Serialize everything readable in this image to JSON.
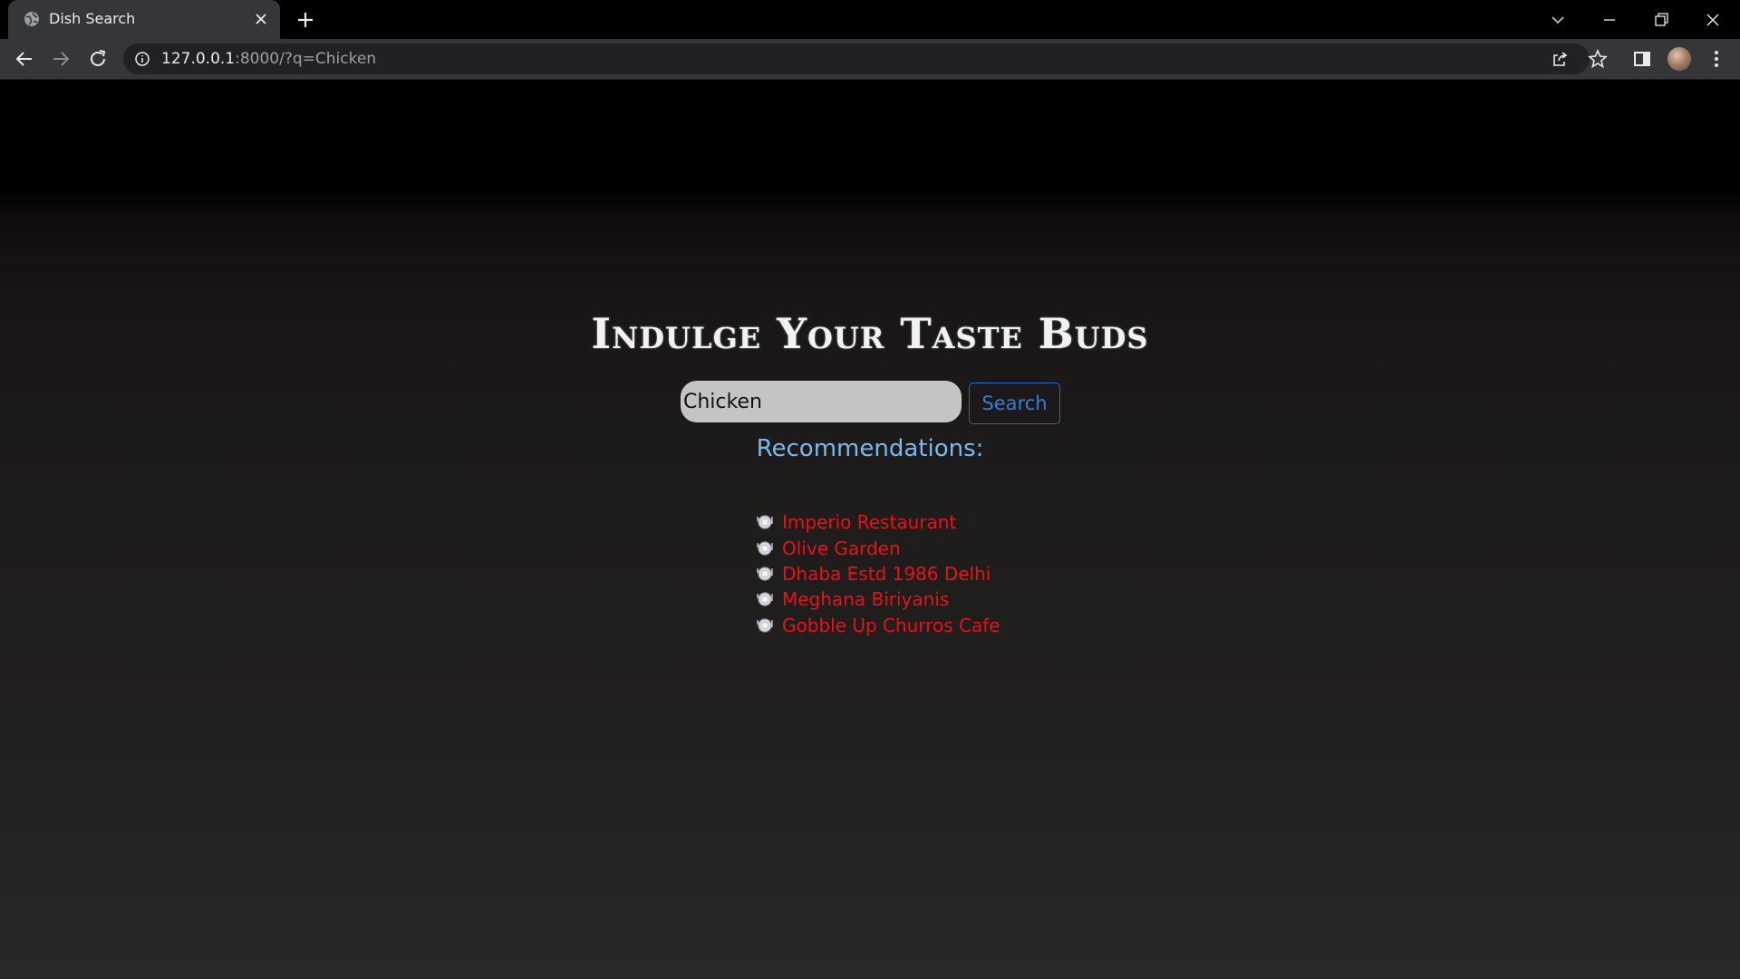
{
  "browser": {
    "tab_title": "Dish Search",
    "url_host": "127.0.0.1",
    "url_rest": ":8000/?q=Chicken"
  },
  "page": {
    "heading": "Indulge Your Taste Buds",
    "search": {
      "value": "Chicken",
      "button_label": "Search"
    },
    "recommendations_heading": "Recommendations:",
    "recommendations": [
      "Imperio Restaurant",
      "Olive Garden",
      "Dhaba Estd 1986 Delhi",
      "Meghana Biriyanis",
      "Gobble Up Churros Cafe"
    ]
  },
  "colors": {
    "link": "#e5121a",
    "recommendations_heading": "#7ab8ee",
    "button": "#2d7fe0"
  }
}
